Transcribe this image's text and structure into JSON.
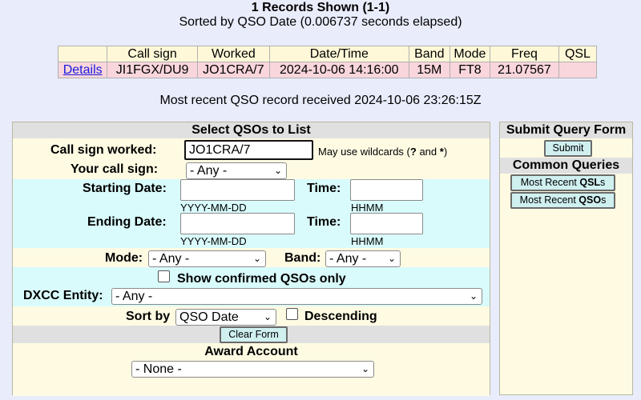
{
  "header": {
    "records_title": "1 Records Shown (1-1)",
    "sorted_line": "Sorted by QSO Date (0.006737 seconds elapsed)"
  },
  "results": {
    "columns": [
      "",
      "Call sign",
      "Worked",
      "Date/Time",
      "Band",
      "Mode",
      "Freq",
      "QSL"
    ],
    "rows": [
      {
        "details": "Details",
        "call_sign": "JI1FGX/DU9",
        "worked": "JO1CRA/7",
        "date_time": "2024-10-06 14:16:00",
        "band": "15M",
        "mode": "FT8",
        "freq": "21.07567",
        "qsl": ""
      }
    ]
  },
  "recent_line": "Most recent QSO record received 2024-10-06 23:26:15Z",
  "form": {
    "title": "Select QSOs to List",
    "call_worked_label": "Call sign worked:",
    "call_worked_value": "JO1CRA/7",
    "wildcard_hint_prefix": "May use wildcards (",
    "wildcard_q": "?",
    "wildcard_and": " and ",
    "wildcard_star": "*",
    "wildcard_hint_suffix": ")",
    "your_call_label": "Your call sign:",
    "your_call_value": "- Any -",
    "start_date_label": "Starting Date:",
    "end_date_label": "Ending Date:",
    "time_label": "Time:",
    "date_format": "YYYY-MM-DD",
    "time_format": "HHMM",
    "mode_label": "Mode:",
    "mode_value": "- Any -",
    "band_label": "Band:",
    "band_value": "- Any -",
    "confirmed_label": "Show confirmed QSOs only",
    "dxcc_label": "DXCC Entity:",
    "dxcc_value": "- Any -",
    "sort_label": "Sort by",
    "sort_value": "QSO Date",
    "descending_label": "Descending",
    "clear_button": "Clear Form",
    "award_title": "Award Account",
    "award_value": "- None -"
  },
  "side": {
    "submit_title": "Submit Query Form",
    "submit_button": "Submit",
    "common_title": "Common Queries",
    "recent_qsls_prefix": "Most Recent ",
    "recent_qsls_bold": "QSL",
    "recent_qsls_suffix": "s",
    "recent_qsos_prefix": "Most Recent ",
    "recent_qsos_bold": "QSO",
    "recent_qsos_suffix": "s"
  }
}
